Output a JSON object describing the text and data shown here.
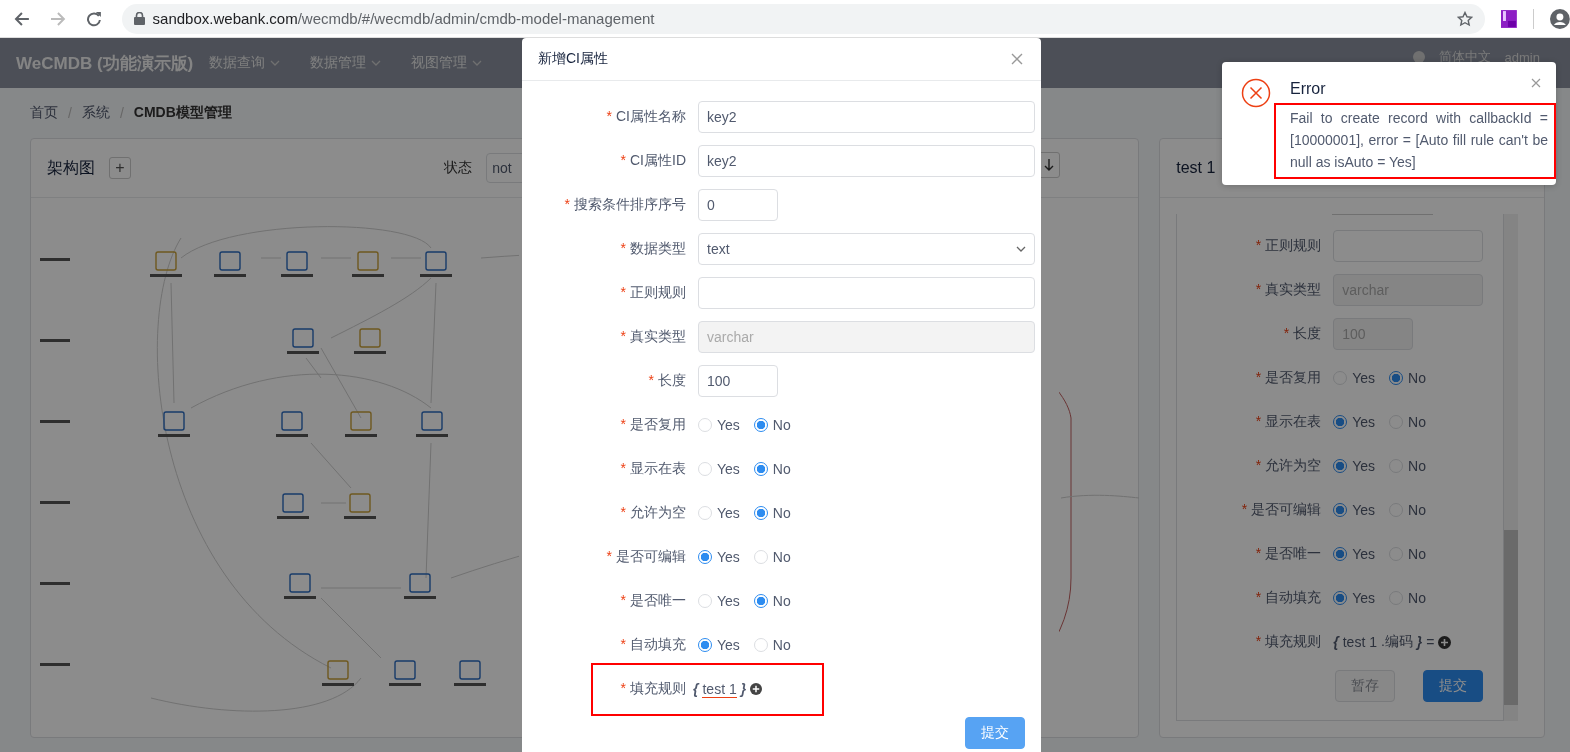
{
  "browser": {
    "url_host": "sandbox.webank.com",
    "url_path": "/wecmdb/#/wecmdb/admin/cmdb-model-management"
  },
  "header": {
    "brand": "WeCMDB (功能演示版)",
    "menus": [
      "数据查询",
      "数据管理",
      "视图管理"
    ],
    "language": "简体中文",
    "user": "admin"
  },
  "breadcrumb": [
    {
      "label": "首页",
      "current": false
    },
    {
      "separator": "/",
      "label": "系统",
      "current": false
    },
    {
      "separator": "/",
      "label": "CMDB模型管理",
      "current": true
    }
  ],
  "diagram_card": {
    "title": "架构图",
    "add_button": "+",
    "status_label": "状态",
    "status_value": "not"
  },
  "detail_card": {
    "title": "test 1",
    "fields": [
      {
        "kind": "input",
        "mark": "*",
        "label": "正则规则"
      },
      {
        "kind": "disabled",
        "mark": "*",
        "label": "真实类型",
        "value": "varchar"
      },
      {
        "kind": "disabled",
        "mark": "*",
        "label": "长度",
        "value": "100",
        "short": true
      },
      {
        "kind": "radio",
        "mark": "*",
        "label": "是否复用",
        "options": [
          {
            "label": "Yes",
            "selected": false
          },
          {
            "label": "No",
            "selected": true
          }
        ]
      },
      {
        "kind": "radio",
        "mark": "*",
        "label": "显示在表",
        "options": [
          {
            "label": "Yes",
            "selected": true
          },
          {
            "label": "No",
            "selected": false
          }
        ]
      },
      {
        "kind": "radio",
        "mark": "*",
        "label": "允许为空",
        "options": [
          {
            "label": "Yes",
            "selected": true
          },
          {
            "label": "No",
            "selected": false
          }
        ]
      },
      {
        "kind": "radio",
        "mark": "*",
        "label": "是否可编辑",
        "options": [
          {
            "label": "Yes",
            "selected": true
          },
          {
            "label": "No",
            "selected": false
          }
        ]
      },
      {
        "kind": "radio",
        "mark": "*",
        "label": "是否唯一",
        "options": [
          {
            "label": "Yes",
            "selected": true
          },
          {
            "label": "No",
            "selected": false
          }
        ]
      },
      {
        "kind": "radio",
        "mark": "*",
        "label": "自动填充",
        "options": [
          {
            "label": "Yes",
            "selected": true
          },
          {
            "label": "No",
            "selected": false
          }
        ]
      },
      {
        "kind": "rule",
        "mark": "*",
        "label": "填充规则",
        "open": "{",
        "parts": [
          "test 1",
          ".编码"
        ],
        "close": "}",
        "suffix": "=",
        "highlighted": false
      }
    ],
    "buttons": [
      {
        "label": "暂存",
        "disabled": true
      },
      {
        "label": "提交",
        "disabled": false
      }
    ]
  },
  "modal": {
    "title": "新增CI属性",
    "fields": [
      {
        "kind": "input",
        "mark": "*",
        "label": "CI属性名称",
        "value": "key2"
      },
      {
        "kind": "input",
        "mark": "*",
        "label": "CI属性ID",
        "value": "key2"
      },
      {
        "kind": "input",
        "mark": "*",
        "label": "搜索条件排序序号",
        "value": "0",
        "short": true
      },
      {
        "kind": "select",
        "mark": "*",
        "label": "数据类型",
        "value": "text"
      },
      {
        "kind": "input",
        "mark": "*",
        "label": "正则规则"
      },
      {
        "kind": "disabled",
        "mark": "*",
        "label": "真实类型",
        "value": "varchar"
      },
      {
        "kind": "input",
        "mark": "*",
        "label": "长度",
        "value": "100",
        "short": true
      },
      {
        "kind": "radio",
        "mark": "*",
        "label": "是否复用",
        "options": [
          {
            "label": "Yes",
            "selected": false
          },
          {
            "label": "No",
            "selected": true
          }
        ]
      },
      {
        "kind": "radio",
        "mark": "*",
        "label": "显示在表",
        "options": [
          {
            "label": "Yes",
            "selected": false
          },
          {
            "label": "No",
            "selected": true
          }
        ]
      },
      {
        "kind": "radio",
        "mark": "*",
        "label": "允许为空",
        "options": [
          {
            "label": "Yes",
            "selected": false
          },
          {
            "label": "No",
            "selected": true
          }
        ]
      },
      {
        "kind": "radio",
        "mark": "*",
        "label": "是否可编辑",
        "options": [
          {
            "label": "Yes",
            "selected": true
          },
          {
            "label": "No",
            "selected": false
          }
        ]
      },
      {
        "kind": "radio",
        "mark": "*",
        "label": "是否唯一",
        "options": [
          {
            "label": "Yes",
            "selected": false
          },
          {
            "label": "No",
            "selected": true
          }
        ]
      },
      {
        "kind": "radio",
        "mark": "*",
        "label": "自动填充",
        "options": [
          {
            "label": "Yes",
            "selected": true
          },
          {
            "label": "No",
            "selected": false
          }
        ]
      },
      {
        "kind": "rule",
        "mark": "*",
        "label": "填充规则",
        "open": "{",
        "parts": [
          "test 1"
        ],
        "close": "}",
        "highlighted": true
      }
    ],
    "submit": "提交"
  },
  "notification": {
    "title": "Error",
    "message": "Fail to create record with callbackId = [10000001], error = [Auto fill rule can't be null as isAuto = Yes]",
    "highlighted": true
  }
}
